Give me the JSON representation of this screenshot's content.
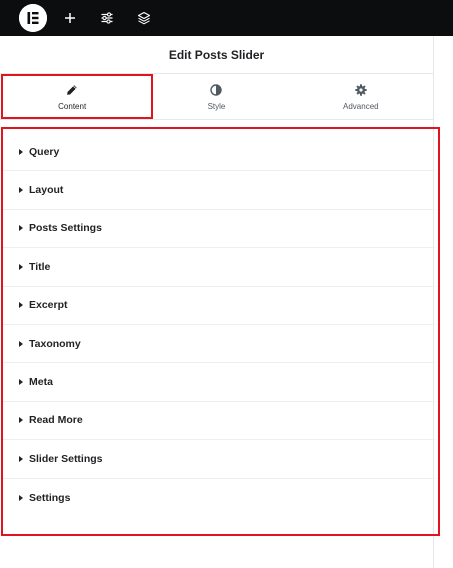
{
  "topbar": {
    "logo_icon": "elementor-logo-icon",
    "buttons": [
      {
        "name": "add-element-button",
        "icon": "plus-icon"
      },
      {
        "name": "site-settings-button",
        "icon": "sliders-icon"
      },
      {
        "name": "structure-button",
        "icon": "layers-icon"
      }
    ]
  },
  "panel": {
    "title": "Edit Posts Slider",
    "tabs": [
      {
        "label": "Content",
        "icon": "pencil-icon",
        "active": true
      },
      {
        "label": "Style",
        "icon": "half-circle-icon",
        "active": false
      },
      {
        "label": "Advanced",
        "icon": "gear-icon",
        "active": false
      }
    ],
    "sections": [
      {
        "label": "Query"
      },
      {
        "label": "Layout"
      },
      {
        "label": "Posts Settings"
      },
      {
        "label": "Title"
      },
      {
        "label": "Excerpt"
      },
      {
        "label": "Taxonomy"
      },
      {
        "label": "Meta"
      },
      {
        "label": "Read More"
      },
      {
        "label": "Slider Settings"
      },
      {
        "label": "Settings"
      }
    ]
  },
  "colors": {
    "topbar": "#0c0d0e",
    "highlight": "#e0141e",
    "text": "#1f2124"
  }
}
